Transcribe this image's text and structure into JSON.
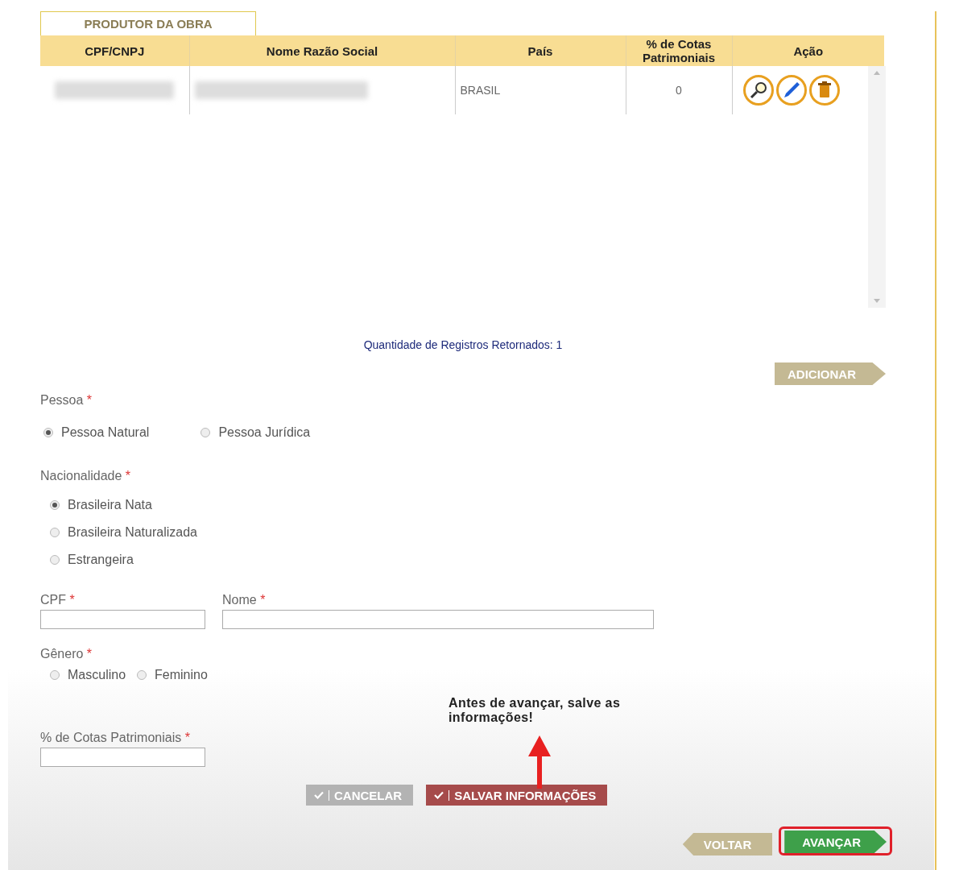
{
  "tab": {
    "label": "PRODUTOR DA OBRA"
  },
  "table": {
    "columns": [
      "CPF/CNPJ",
      "Nome Razão Social",
      "País",
      "% de Cotas Patrimoniais",
      "Ação"
    ],
    "rows": [
      {
        "country": "BRASIL",
        "share": "0"
      }
    ]
  },
  "record_count": "Quantidade de Registros Retornados: 1",
  "add_button": "ADICIONAR",
  "pessoa": {
    "label": "Pessoa",
    "mark": "*",
    "options": [
      {
        "label": "Pessoa Natural",
        "selected": true
      },
      {
        "label": "Pessoa Jurídica",
        "selected": false
      }
    ]
  },
  "nacionalidade": {
    "label": "Nacionalidade",
    "mark": "*",
    "options": [
      {
        "label": "Brasileira Nata",
        "selected": true
      },
      {
        "label": "Brasileira Naturalizada",
        "selected": false
      },
      {
        "label": "Estrangeira",
        "selected": false
      }
    ]
  },
  "cpf": {
    "label": "CPF",
    "mark": "*"
  },
  "nome": {
    "label": "Nome",
    "mark": "*"
  },
  "genero": {
    "label": "Gênero",
    "mark": "*",
    "options": [
      {
        "label": "Masculino",
        "selected": false
      },
      {
        "label": "Feminino",
        "selected": false
      }
    ]
  },
  "cotas": {
    "label": "% de Cotas Patrimoniais",
    "mark": "*"
  },
  "annotation": "Antes de avançar, salve as informações!",
  "buttons": [
    {
      "label": "CANCELAR",
      "kind": "cancel"
    },
    {
      "label": "SALVAR INFORMAÇÕES",
      "kind": "save"
    }
  ],
  "nav": [
    {
      "label": "VOLTAR",
      "kind": "back",
      "highlighted": false
    },
    {
      "label": "AVANÇAR",
      "kind": "next",
      "highlighted": true
    }
  ]
}
